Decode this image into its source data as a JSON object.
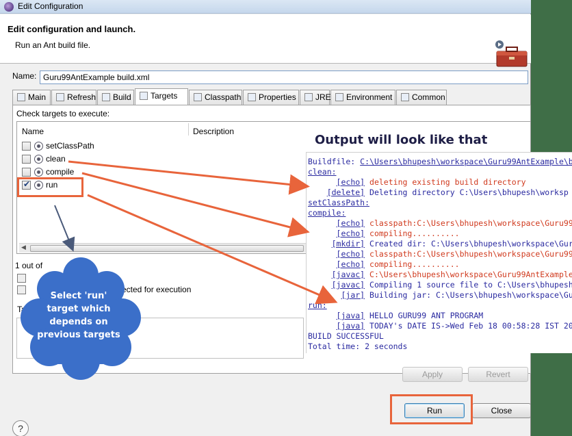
{
  "window": {
    "title": "Edit Configuration"
  },
  "banner": {
    "heading": "Edit configuration and launch.",
    "subtitle": "Run an Ant build file."
  },
  "name_field": {
    "label": "Name:",
    "value": "Guru99AntExample build.xml"
  },
  "tabs": [
    {
      "label": "Main",
      "icon": "main-icon"
    },
    {
      "label": "Refresh",
      "icon": "refresh-icon"
    },
    {
      "label": "Build",
      "icon": "build-icon"
    },
    {
      "label": "Targets",
      "icon": "targets-icon"
    },
    {
      "label": "Classpath",
      "icon": "classpath-icon"
    },
    {
      "label": "Properties",
      "icon": "properties-icon"
    },
    {
      "label": "JRE",
      "icon": "jre-icon"
    },
    {
      "label": "Environment",
      "icon": "environment-icon"
    },
    {
      "label": "Common",
      "icon": "common-icon"
    }
  ],
  "targets": {
    "prompt": "Check targets to execute:",
    "columns": {
      "name": "Name",
      "description": "Description"
    },
    "rows": [
      {
        "name": "setClassPath",
        "checked": false
      },
      {
        "name": "clean",
        "checked": false
      },
      {
        "name": "compile",
        "checked": false
      },
      {
        "name": "run",
        "checked": true
      }
    ],
    "selected_count": "1 out of",
    "option_partial": "ected for execution",
    "sort_partial": "Ta"
  },
  "buttons": {
    "apply": "Apply",
    "revert": "Revert",
    "run": "Run",
    "close": "Close",
    "help": "?"
  },
  "overlay": {
    "title": "Output will look like that",
    "console_lines": [
      {
        "kind": "buildfile",
        "text": "Buildfile: ",
        "link": "C:\\Users\\bhupesh\\workspace\\Guru99AntExample\\b"
      },
      {
        "kind": "target",
        "text": "clean:"
      },
      {
        "kind": "task-red",
        "tag": "[echo]",
        "text": "deleting existing build directory",
        "indent": "      "
      },
      {
        "kind": "task",
        "tag": "[delete]",
        "text": "Deleting directory C:\\Users\\bhupesh\\worksp",
        "indent": "    "
      },
      {
        "kind": "target",
        "text": "setClassPath:"
      },
      {
        "kind": "target",
        "text": "compile:"
      },
      {
        "kind": "task-red",
        "tag": "[echo]",
        "text": "classpath:C:\\Users\\bhupesh\\workspace\\Guru99A",
        "indent": "      "
      },
      {
        "kind": "task-red",
        "tag": "[echo]",
        "text": "compiling..........",
        "indent": "      "
      },
      {
        "kind": "task",
        "tag": "[mkdir]",
        "text": "Created dir: C:\\Users\\bhupesh\\workspace\\Guru",
        "indent": "     "
      },
      {
        "kind": "task-red",
        "tag": "[echo]",
        "text": "classpath:C:\\Users\\bhupesh\\workspace\\Guru99A",
        "indent": "      "
      },
      {
        "kind": "task-red",
        "tag": "[echo]",
        "text": "compiling..........",
        "indent": "      "
      },
      {
        "kind": "task-red",
        "tag": "[javac]",
        "text": "C:\\Users\\bhupesh\\workspace\\Guru99AntExample",
        "indent": "     "
      },
      {
        "kind": "task",
        "tag": "[javac]",
        "text": "Compiling 1 source file to C:\\Users\\bhupesh\\",
        "indent": "     "
      },
      {
        "kind": "task",
        "tag": "[jar]",
        "text": "Building jar: C:\\Users\\bhupesh\\workspace\\Guru",
        "indent": "       "
      },
      {
        "kind": "target",
        "text": "run:"
      },
      {
        "kind": "task",
        "tag": "[java]",
        "text": "HELLO GURU99 ANT PROGRAM",
        "indent": "      "
      },
      {
        "kind": "task",
        "tag": "[java]",
        "text": "TODAY's DATE IS->Wed Feb 18 00:58:28 IST 201",
        "indent": "      "
      },
      {
        "kind": "plain",
        "text": "BUILD SUCCESSFUL"
      },
      {
        "kind": "plain",
        "text": "Total time: 2 seconds"
      }
    ],
    "callout": "Select 'run' target which depends on previous targets"
  },
  "colors": {
    "annotation_orange": "#e8643b",
    "callout_blue": "#3b6fc9",
    "console_blue": "#2a2aa0",
    "console_red": "#d03a1e"
  }
}
